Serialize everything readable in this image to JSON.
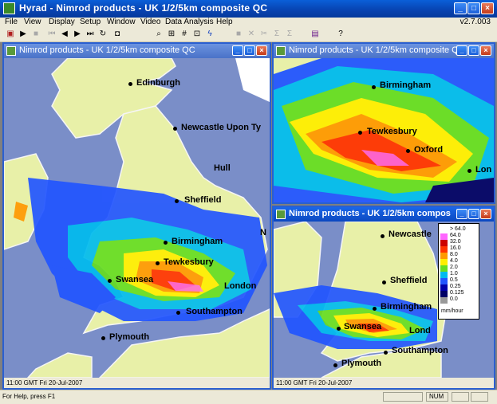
{
  "app": {
    "title": "Hyrad - Nimrod products - UK 1/2/5km composite QC",
    "version": "v2.7.003"
  },
  "menu": [
    "File",
    "View",
    "Display",
    "Setup",
    "Window",
    "Video",
    "Data Analysis",
    "Help"
  ],
  "toolbar_icons": [
    "film-icon",
    "play-icon",
    "stop-icon",
    "first-frame-icon",
    "prev-frame-icon",
    "next-frame-icon",
    "last-frame-icon",
    "loop-icon",
    "camera-icon",
    "zoom-icon",
    "pan-icon",
    "grid-icon",
    "measure-icon",
    "database-icon",
    "lightning-icon",
    "square-icon",
    "cross-icon",
    "cut-icon",
    "sigma-icon",
    "sigma-chart-icon",
    "filmstrip-icon",
    "help-pointer-icon"
  ],
  "windows": [
    {
      "title": "Nimrod products - UK 1/2/5km composite QC",
      "status": "11:00 GMT Fri 20-Jul-2007",
      "places": [
        "Edinburgh",
        "Newcastle Upon Ty",
        "Hull",
        "Sheffield",
        "Birmingham",
        "Tewkesbury",
        "Swansea",
        "London",
        "Southampton",
        "Plymouth",
        "N"
      ]
    },
    {
      "title": "Nimrod products - UK 1/2/5km composite QC",
      "places": [
        "Birmingham",
        "Tewkesbury",
        "Oxford",
        "Lon"
      ]
    },
    {
      "title": "Nimrod products - UK 1/2/5km compos",
      "status": "11:00 GMT Fri 20-Jul-2007",
      "places": [
        "Newcastle",
        "Sheffield",
        "Birmingham",
        "Swansea",
        "Lond",
        "Southampton",
        "Plymouth"
      ]
    }
  ],
  "legend": {
    "items": [
      {
        "label": "> 64.0",
        "color": "#ffffff"
      },
      {
        "label": "64.0",
        "color": "#ff66ff"
      },
      {
        "label": "32.0",
        "color": "#cc0000"
      },
      {
        "label": "16.0",
        "color": "#ff3300"
      },
      {
        "label": "8.0",
        "color": "#ff9900"
      },
      {
        "label": "4.0",
        "color": "#ffee00"
      },
      {
        "label": "2.0",
        "color": "#66dd22"
      },
      {
        "label": "1.0",
        "color": "#00bbee"
      },
      {
        "label": "0.5",
        "color": "#2255ff"
      },
      {
        "label": "0.25",
        "color": "#0000aa"
      },
      {
        "label": "0.125",
        "color": "#000066"
      },
      {
        "label": "0.0",
        "color": "#999999"
      }
    ],
    "unit": "mm/hour"
  },
  "statusbar": {
    "help": "For Help, press F1",
    "num": "NUM"
  },
  "colors": {
    "sea": "#7a8ec8",
    "land": "#e8f0a8",
    "coast": "#f5f5f5"
  }
}
